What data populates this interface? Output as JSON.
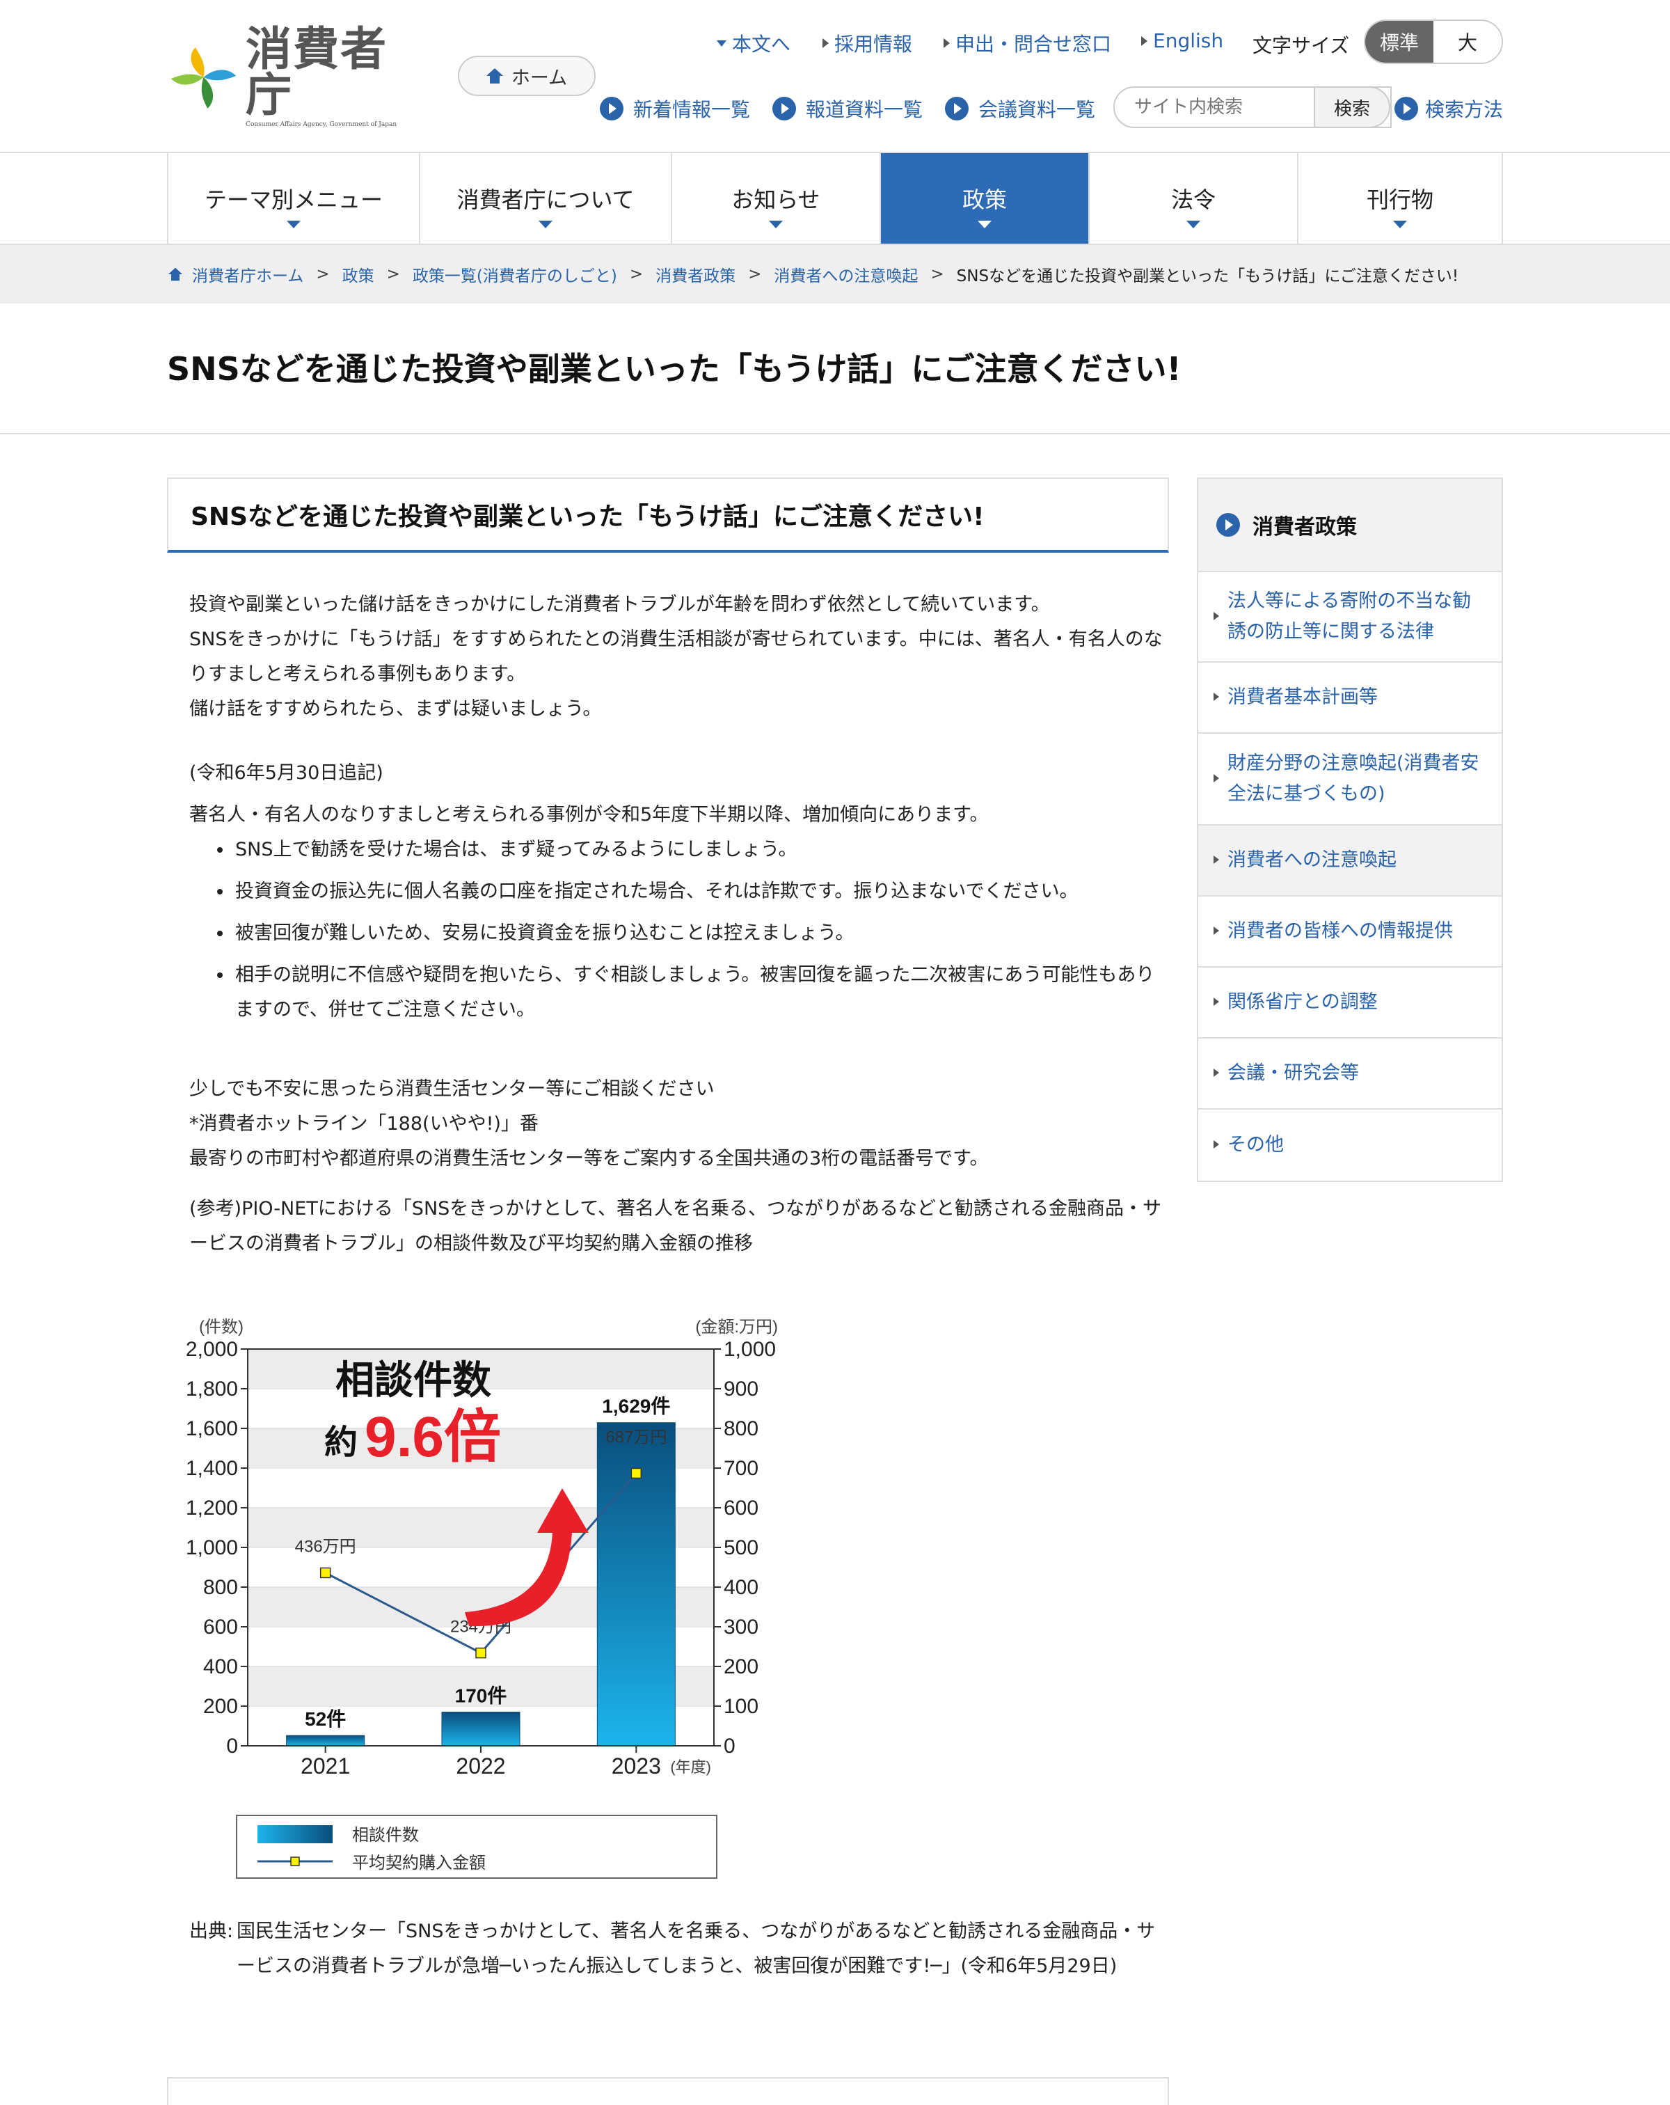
{
  "header": {
    "logo_text": "消費者庁",
    "logo_sub": "Consumer Affairs Agency, Government of Japan",
    "home_label": "ホーム",
    "top_links": [
      {
        "label": "本文へ",
        "marker": "down"
      },
      {
        "label": "採用情報",
        "marker": "right"
      },
      {
        "label": "申出・問合せ窓口",
        "marker": "right"
      },
      {
        "label": "English",
        "marker": "right"
      }
    ],
    "font_size_label": "文字サイズ",
    "font_size_options": [
      "標準",
      "大"
    ],
    "font_size_selected": "標準",
    "sub_links": [
      "新着情報一覧",
      "報道資料一覧",
      "会議資料一覧"
    ],
    "search_placeholder": "サイト内検索",
    "search_button": "検索",
    "search_help": "検索方法"
  },
  "global_nav": [
    {
      "label": "テーマ別メニュー",
      "active": false
    },
    {
      "label": "消費者庁について",
      "active": false
    },
    {
      "label": "お知らせ",
      "active": false
    },
    {
      "label": "政策",
      "active": true
    },
    {
      "label": "法令",
      "active": false
    },
    {
      "label": "刊行物",
      "active": false
    }
  ],
  "breadcrumb": {
    "home": "消費者庁ホーム",
    "items": [
      "政策",
      "政策一覧(消費者庁のしごと)",
      "消費者政策",
      "消費者への注意喚起"
    ],
    "current": "SNSなどを通じた投資や副業といった「もうけ話」にご注意ください!"
  },
  "page_title": "SNSなどを通じた投資や副業といった「もうけ話」にご注意ください!",
  "article": {
    "section_title": "SNSなどを通じた投資や副業といった「もうけ話」にご注意ください!",
    "intro": [
      "投資や副業といった儲け話をきっかけにした消費者トラブルが年齢を問わず依然として続いています。",
      "SNSをきっかけに「もうけ話」をすすめられたとの消費生活相談が寄せられています。中には、著名人・有名人のなりすましと考えられる事例もあります。",
      "儲け話をすすめられたら、まずは疑いましょう。"
    ],
    "added_date": "(令和6年5月30日追記)",
    "added_text": "著名人・有名人のなりすましと考えられる事例が令和5年度下半期以降、増加傾向にあります。",
    "bullets": [
      "SNS上で勧誘を受けた場合は、まず疑ってみるようにしましょう。",
      "投資資金の振込先に個人名義の口座を指定された場合、それは詐欺です。振り込まないでください。",
      "被害回復が難しいため、安易に投資資金を振り込むことは控えましょう。",
      "相手の説明に不信感や疑問を抱いたら、すぐ相談しましょう。被害回復を謳った二次被害にあう可能性もありますので、併せてご注意ください。"
    ],
    "consult": [
      "少しでも不安に思ったら消費生活センター等にご相談ください",
      "*消費者ホットライン「188(いやや!)」番",
      "最寄りの市町村や都道府県の消費生活センター等をご案内する全国共通の3桁の電話番号です。"
    ],
    "reference": "(参考)PIO-NETにおける「SNSをきっかけとして、著名人を名乗る、つながりがあるなどと勧誘される金融商品・サービスの消費者トラブル」の相談件数及び平均契約購入金額の推移",
    "source_label": "出典:",
    "source_text": "国民生活センター「SNSをきっかけとして、著名人を名乗る、つながりがあるなどと勧誘される金融商品・サービスの消費者トラブルが急増─いったん振込してしまうと、被害回復が困難です!─」(令和6年5月29日)"
  },
  "chart_data": {
    "type": "bar",
    "categories": [
      "2021",
      "2022",
      "2023"
    ],
    "x_unit": "(年度)",
    "series": [
      {
        "name": "相談件数",
        "type": "bar",
        "axis": "left",
        "values": [
          52,
          170,
          1629
        ],
        "labels": [
          "52件",
          "170件",
          "1,629件"
        ]
      },
      {
        "name": "平均契約購入金額",
        "type": "line",
        "axis": "right",
        "values": [
          436,
          234,
          687
        ],
        "labels": [
          "436万円",
          "234万円",
          "687万円"
        ]
      }
    ],
    "ylabel_left": "(件数)",
    "ylabel_right": "(金額:万円)",
    "ylim_left": [
      0,
      2000
    ],
    "ylim_right": [
      0,
      1000
    ],
    "yticks_left": [
      "0",
      "200",
      "400",
      "600",
      "800",
      "1,000",
      "1,200",
      "1,400",
      "1,600",
      "1,800",
      "2,000"
    ],
    "yticks_right": [
      "0",
      "100",
      "200",
      "300",
      "400",
      "500",
      "600",
      "700",
      "800",
      "900",
      "1,000"
    ],
    "annotation_line1": "相談件数",
    "annotation_prefix": "約",
    "annotation_value": "9.6倍",
    "legend_position": "bottom",
    "bar_color": "#1a8fc7",
    "line_color": "#2a5a8c",
    "grid": true
  },
  "sidebar": {
    "title": "消費者政策",
    "items": [
      {
        "label": "法人等による寄附の不当な勧誘の防止等に関する法律",
        "current": false
      },
      {
        "label": "消費者基本計画等",
        "current": false
      },
      {
        "label": "財産分野の注意喚起(消費者安全法に基づくもの)",
        "current": false
      },
      {
        "label": "消費者への注意喚起",
        "current": true
      },
      {
        "label": "消費者の皆様への情報提供",
        "current": false
      },
      {
        "label": "関係省庁との調整",
        "current": false
      },
      {
        "label": "会議・研究会等",
        "current": false
      },
      {
        "label": "その他",
        "current": false
      }
    ]
  },
  "colors": {
    "accent": "#2d6bb6",
    "link": "#2a63aa",
    "breadcrumb_bg": "#efefef",
    "annotation_red": "#e8202a"
  }
}
